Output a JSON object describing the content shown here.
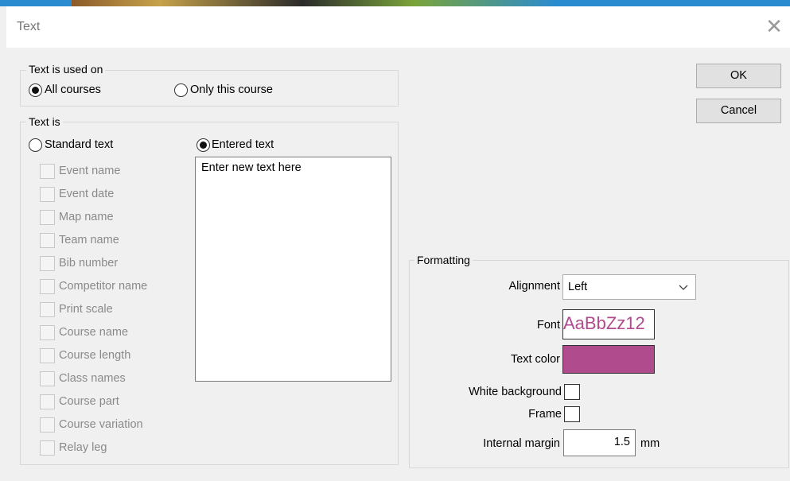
{
  "dialog": {
    "title": "Text"
  },
  "used_on": {
    "legend": "Text is used on",
    "options": [
      {
        "label": "All courses",
        "checked": true
      },
      {
        "label": "Only this course",
        "checked": false
      }
    ]
  },
  "text_is": {
    "legend": "Text is",
    "standard": {
      "label": "Standard text",
      "checked": false
    },
    "entered": {
      "label": "Entered text",
      "checked": true
    },
    "entered_value": "Enter new text here",
    "standard_items": [
      "Event name",
      "Event date",
      "Map name",
      "Team name",
      "Bib number",
      "Competitor name",
      "Print scale",
      "Course name",
      "Course length",
      "Class names",
      "Course part",
      "Course variation",
      "Relay leg"
    ]
  },
  "buttons": {
    "ok": "OK",
    "cancel": "Cancel"
  },
  "formatting": {
    "legend": "Formatting",
    "alignment_label": "Alignment",
    "alignment_value": "Left",
    "font_label": "Font",
    "font_sample": "AaBbZz12",
    "text_color_label": "Text color",
    "text_color": "#b04b8e",
    "white_background_label": "White background",
    "frame_label": "Frame",
    "internal_margin_label": "Internal margin",
    "internal_margin_value": "1.5",
    "internal_margin_unit": "mm"
  }
}
